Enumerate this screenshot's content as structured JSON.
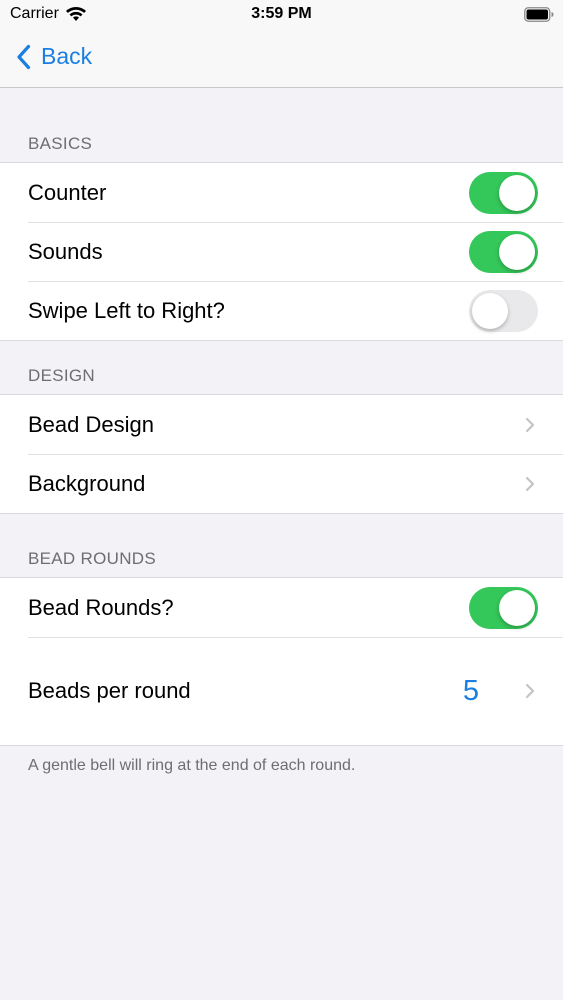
{
  "status_bar": {
    "carrier": "Carrier",
    "time": "3:59 PM",
    "wifi_icon": "wifi-icon",
    "battery_icon": "battery-icon"
  },
  "nav": {
    "back_label": "Back",
    "back_icon": "chevron-left-icon",
    "accent_color": "#1a7fe0"
  },
  "sections": {
    "basics": {
      "header": "BASICS",
      "counter_label": "Counter",
      "counter_on": true,
      "sounds_label": "Sounds",
      "sounds_on": true,
      "swipe_label": "Swipe Left to Right?",
      "swipe_on": false
    },
    "design": {
      "header": "DESIGN",
      "bead_design_label": "Bead Design",
      "background_label": "Background"
    },
    "bead_rounds": {
      "header": "BEAD ROUNDS",
      "bead_rounds_label": "Bead Rounds?",
      "bead_rounds_on": true,
      "beads_per_round_label": "Beads per round",
      "beads_per_round_value": "5",
      "footer": "A gentle bell will ring at the end of each round."
    }
  },
  "colors": {
    "toggle_on": "#34c759",
    "toggle_off": "#e9e9eb",
    "background": "#f2f2f7"
  }
}
